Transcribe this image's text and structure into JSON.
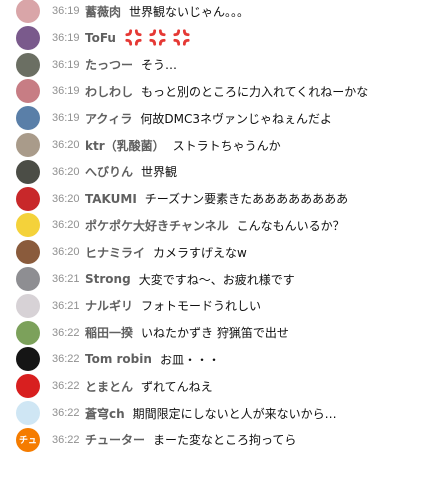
{
  "messages": [
    {
      "avatar_icon": "avatar-pink-flower",
      "avatar_color": "#d9a5a8",
      "time": "36:19",
      "author": "蓄薇肉",
      "text": "世界観ないじゃん。。。"
    },
    {
      "avatar_icon": "avatar-anime-girl",
      "avatar_color": "#7a5a8c",
      "time": "36:19",
      "author": "ToFu",
      "text": "",
      "emojis": [
        "anger-symbol-icon",
        "anger-symbol-icon",
        "anger-symbol-icon"
      ]
    },
    {
      "avatar_icon": "avatar-landscape",
      "avatar_color": "#6b6f63",
      "time": "36:19",
      "author": "たっつー",
      "text": "そう…"
    },
    {
      "avatar_icon": "avatar-pink-character",
      "avatar_color": "#c77d84",
      "time": "36:19",
      "author": "わしわし",
      "text": "もっと別のところに力入れてくれねーかな"
    },
    {
      "avatar_icon": "avatar-sky",
      "avatar_color": "#5a7fa8",
      "time": "36:19",
      "author": "アクィラ",
      "text": "何故DMC3ネヴァンじゃねぇんだよ"
    },
    {
      "avatar_icon": "avatar-cat",
      "avatar_color": "#a99b8a",
      "time": "36:20",
      "author": "ktr（乳酸菌）",
      "text": "ストラトちゃうんか"
    },
    {
      "avatar_icon": "avatar-dark-figure",
      "avatar_color": "#4b4d46",
      "time": "36:20",
      "author": "へびりん",
      "text": "世界観"
    },
    {
      "avatar_icon": "avatar-red-logo",
      "avatar_color": "#c8282a",
      "time": "36:20",
      "author": "TAKUMI",
      "text": "チーズナン要素きたああああああああ"
    },
    {
      "avatar_icon": "avatar-pikachu",
      "avatar_color": "#f4d23a",
      "time": "36:20",
      "author": "ポケポケ大好きチャンネル",
      "text": "こんなもんいるか？"
    },
    {
      "avatar_icon": "avatar-brown-character",
      "avatar_color": "#8a5b3c",
      "time": "36:20",
      "author": "ヒナミライ",
      "text": "カメラすげえなw"
    },
    {
      "avatar_icon": "avatar-gray-character",
      "avatar_color": "#8e8e92",
      "time": "36:21",
      "author": "Strong",
      "text": "大変ですね〜、お疲れ様です"
    },
    {
      "avatar_icon": "avatar-white-character",
      "avatar_color": "#d7d2d6",
      "time": "36:21",
      "author": "ナルギリ",
      "text": "フォトモードうれしい"
    },
    {
      "avatar_icon": "avatar-green-figure",
      "avatar_color": "#7ca15b",
      "time": "36:22",
      "author": "稲田一揆",
      "text": "いねたかずき 狩猟笛で出せ"
    },
    {
      "avatar_icon": "avatar-black-circle",
      "avatar_color": "#151515",
      "time": "36:22",
      "author": "Tom robin",
      "text": "お皿・・・"
    },
    {
      "avatar_icon": "avatar-red-apple",
      "avatar_color": "#d81f1f",
      "time": "36:22",
      "author": "とまとん",
      "text": "ずれてんねえ"
    },
    {
      "avatar_icon": "avatar-light-blue",
      "avatar_color": "#cfe6f4",
      "time": "36:22",
      "author": "蒼穹ch",
      "text": "期間限定にしないと人が来ないから…"
    },
    {
      "avatar_icon": "avatar-letter",
      "avatar_color": "#f57c00",
      "avatar_letter": "チュ",
      "time": "36:22",
      "author": "チューター",
      "text": "まーた変なところ拘ってら"
    }
  ],
  "colors": {
    "time": "#909090",
    "author": "#606060",
    "text": "#0f0f0f",
    "anger": "#e53935"
  }
}
